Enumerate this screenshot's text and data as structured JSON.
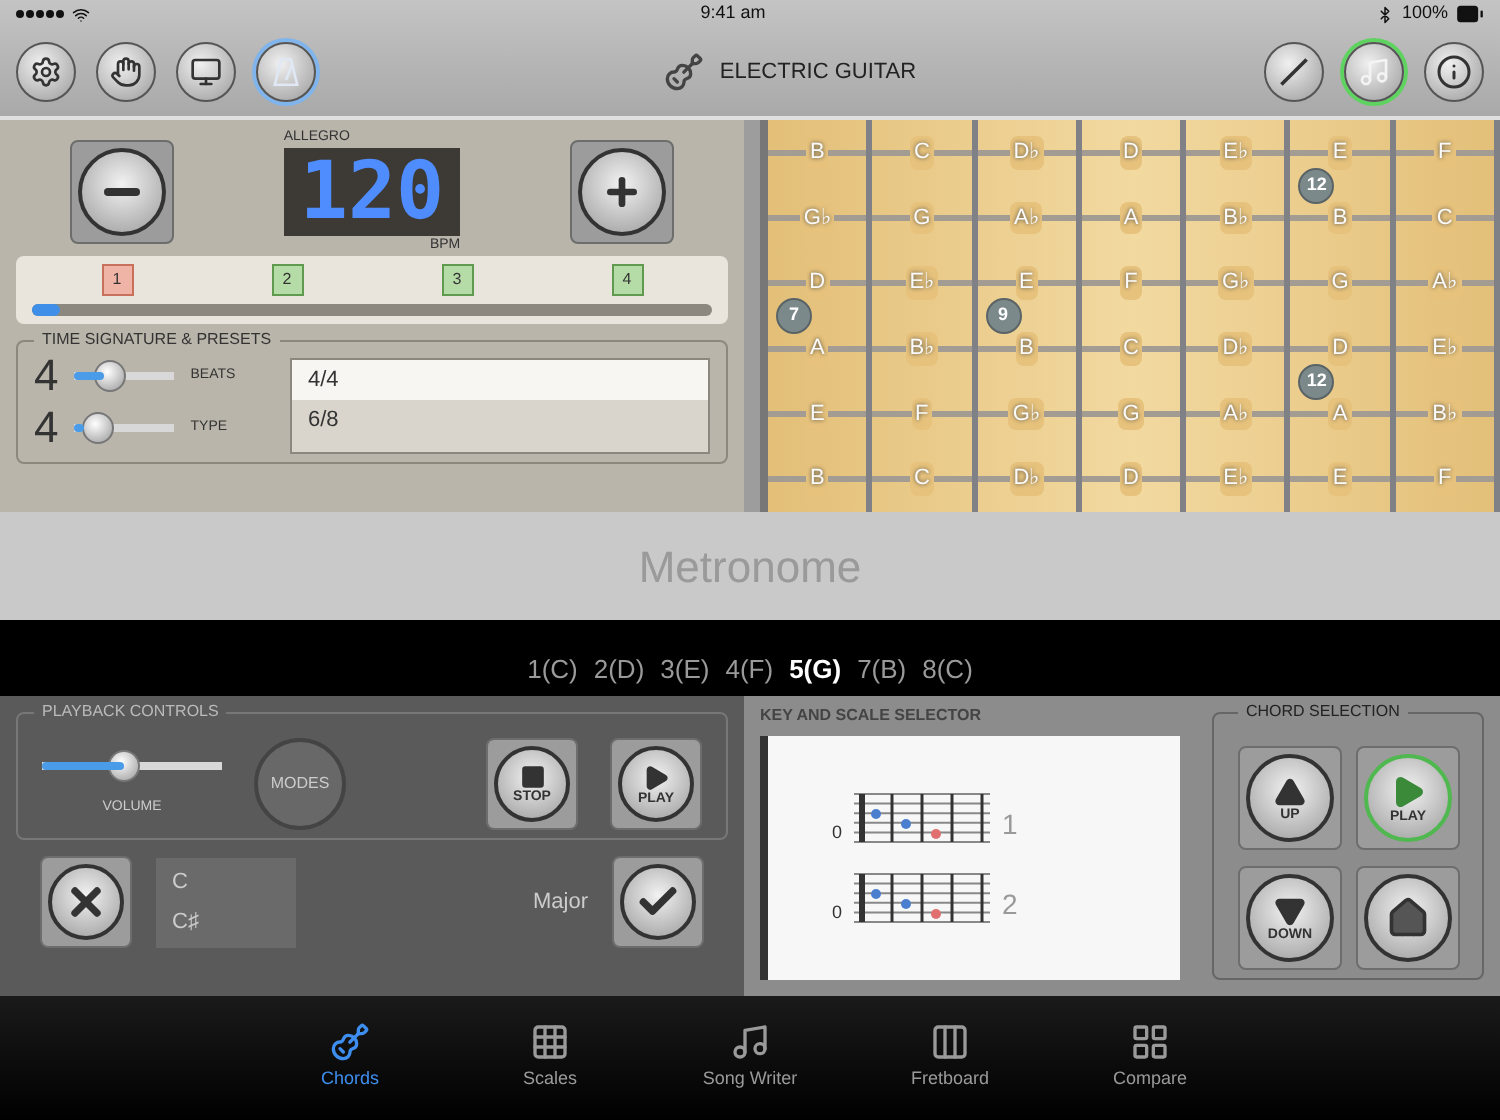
{
  "status_bar": {
    "time": "9:41 am",
    "battery": "100%"
  },
  "toolbar": {
    "title": "ELECTRIC GUITAR",
    "left_buttons": [
      {
        "selected": false
      },
      {
        "selected": false
      },
      {
        "selected": false
      },
      {
        "selected": true
      }
    ],
    "right_buttons": [
      {
        "selected": false
      },
      {
        "selected": true
      },
      {
        "selected": false
      }
    ]
  },
  "metronome": {
    "tempo_name": "ALLEGRO",
    "bpm": "120",
    "bpm_unit": "BPM",
    "beats": [
      {
        "label": "1",
        "kind": "accent"
      },
      {
        "label": "2",
        "kind": "normal"
      },
      {
        "label": "3",
        "kind": "normal"
      },
      {
        "label": "4",
        "kind": "normal"
      }
    ],
    "progress": {
      "level": 0.04
    },
    "time_signature": {
      "title": "TIME SIGNATURE & PRESETS",
      "beats_value": "4",
      "beats_label": "BEATS",
      "beats_slider": {
        "level": 0.3
      },
      "type_value": "4",
      "type_label": "TYPE",
      "type_slider": {
        "level": 0.1
      },
      "presets": [
        {
          "label": "4/4",
          "selected": true
        },
        {
          "label": "6/8",
          "selected": false
        }
      ]
    }
  },
  "fretboard": {
    "strings": [
      {
        "notes": [
          {
            "note": "B"
          },
          {
            "note": "C"
          },
          {
            "note": "D♭"
          },
          {
            "note": "D"
          },
          {
            "note": "E♭"
          },
          {
            "note": "E",
            "marker": "12"
          },
          {
            "note": "F"
          }
        ]
      },
      {
        "notes": [
          {
            "note": "G♭"
          },
          {
            "note": "G"
          },
          {
            "note": "A♭"
          },
          {
            "note": "A"
          },
          {
            "note": "B♭"
          },
          {
            "note": "B"
          },
          {
            "note": "C"
          }
        ]
      },
      {
        "notes": [
          {
            "note": "D",
            "marker": "7"
          },
          {
            "note": "E♭"
          },
          {
            "note": "E",
            "marker": "9"
          },
          {
            "note": "F"
          },
          {
            "note": "G♭"
          },
          {
            "note": "G"
          },
          {
            "note": "A♭"
          }
        ]
      },
      {
        "notes": [
          {
            "note": "A"
          },
          {
            "note": "B♭"
          },
          {
            "note": "B"
          },
          {
            "note": "C"
          },
          {
            "note": "D♭"
          },
          {
            "note": "D",
            "marker": "12"
          },
          {
            "note": "E♭"
          }
        ]
      },
      {
        "notes": [
          {
            "note": "E"
          },
          {
            "note": "F"
          },
          {
            "note": "G♭"
          },
          {
            "note": "G"
          },
          {
            "note": "A♭"
          },
          {
            "note": "A"
          },
          {
            "note": "B♭"
          }
        ]
      },
      {
        "notes": [
          {
            "note": "B"
          },
          {
            "note": "C"
          },
          {
            "note": "D♭"
          },
          {
            "note": "D"
          },
          {
            "note": "E♭"
          },
          {
            "note": "E"
          },
          {
            "note": "F"
          }
        ]
      }
    ]
  },
  "banner": {
    "title": "Metronome"
  },
  "degrees": [
    {
      "label": "1(C)",
      "selected": false
    },
    {
      "label": "2(D)",
      "selected": false
    },
    {
      "label": "3(E)",
      "selected": false
    },
    {
      "label": "4(F)",
      "selected": false
    },
    {
      "label": "5(G)",
      "selected": true
    },
    {
      "label": "7(B)",
      "selected": false
    },
    {
      "label": "8(C)",
      "selected": false
    }
  ],
  "playback": {
    "title": "PLAYBACK CONTROLS",
    "volume": {
      "label": "VOLUME",
      "level": 0.45
    },
    "modes": "MODES",
    "stop": "STOP",
    "play": "PLAY"
  },
  "key_scale": {
    "title": "KEY AND SCALE SELECTOR",
    "keys": [
      "C",
      "C♯"
    ],
    "scale": "Major"
  },
  "chords": [
    {
      "fret": "0",
      "number": "1"
    },
    {
      "fret": "0",
      "number": "2"
    }
  ],
  "chord_selection": {
    "title": "CHORD SELECTION",
    "buttons": [
      {
        "kind": "up",
        "label": "UP",
        "selected": false
      },
      {
        "kind": "play",
        "label": "PLAY",
        "selected": true
      },
      {
        "kind": "down",
        "label": "DOWN",
        "selected": false
      },
      {
        "kind": "home",
        "selected": false
      }
    ]
  },
  "tabs": [
    {
      "label": "Chords",
      "selected": true
    },
    {
      "label": "Scales",
      "selected": false
    },
    {
      "label": "Song Writer",
      "selected": false
    },
    {
      "label": "Fretboard",
      "selected": false
    },
    {
      "label": "Compare",
      "selected": false
    }
  ]
}
